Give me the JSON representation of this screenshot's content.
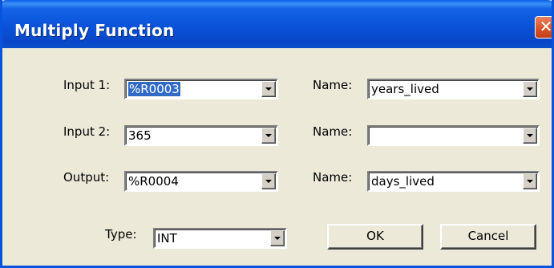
{
  "window": {
    "title": "Multiply Function",
    "close_glyph": "✕"
  },
  "fields": {
    "input1": {
      "label": "Input 1:",
      "value": "%R0003",
      "name_label": "Name:",
      "name_value": "years_lived"
    },
    "input2": {
      "label": "Input 2:",
      "value": "365",
      "name_label": "Name:",
      "name_value": ""
    },
    "output": {
      "label": "Output:",
      "value": "%R0004",
      "name_label": "Name:",
      "name_value": "days_lived"
    },
    "type": {
      "label": "Type:",
      "value": "INT"
    }
  },
  "buttons": {
    "ok_label": "OK",
    "cancel_label": "Cancel"
  },
  "icons": {
    "close": "close-icon",
    "dropdown": "chevron-down-icon"
  },
  "colors": {
    "titlebar": "#0a52d8",
    "dialog_bg": "#ece9d8",
    "selection": "#316ac5",
    "close_button": "#d9542a"
  }
}
